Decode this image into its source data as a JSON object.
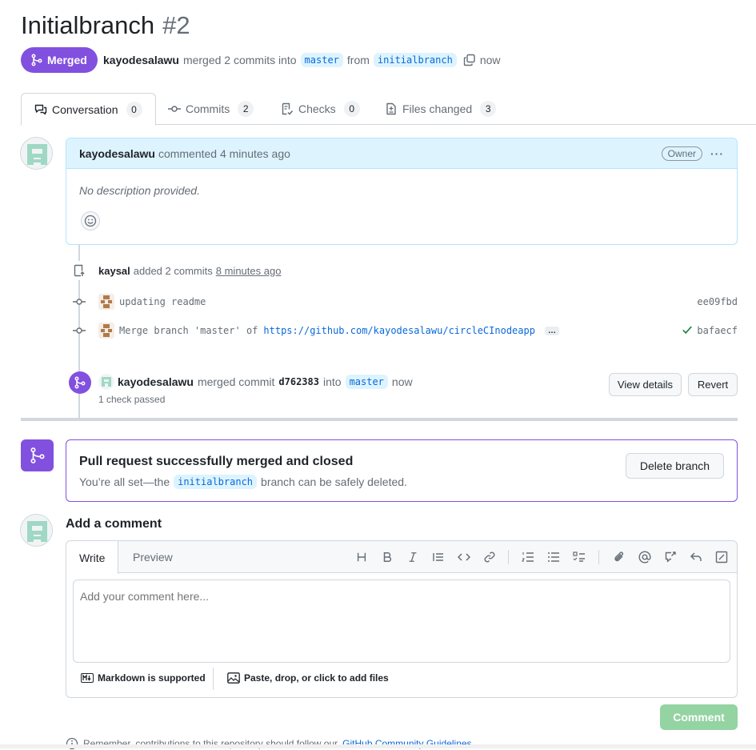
{
  "pr": {
    "title": "Initialbranch",
    "number": "#2",
    "status": "Merged",
    "author": "kayodesalawu",
    "merged_text": "merged 2 commits into",
    "base_branch": "master",
    "from_text": "from",
    "head_branch": "initialbranch",
    "time": "now"
  },
  "tabs": [
    {
      "label": "Conversation",
      "count": "0"
    },
    {
      "label": "Commits",
      "count": "2"
    },
    {
      "label": "Checks",
      "count": "0"
    },
    {
      "label": "Files changed",
      "count": "3"
    }
  ],
  "comment": {
    "author": "kayodesalawu",
    "action": "commented 4 minutes ago",
    "role": "Owner",
    "body": "No description provided."
  },
  "commits_event": {
    "user": "kaysal",
    "action": "added 2 commits",
    "time": "8 minutes ago",
    "commits": [
      {
        "message": "updating readme",
        "sha": "ee09fbd"
      },
      {
        "message_prefix": "Merge branch 'master' of",
        "link": "https://github.com/kayodesalawu/circleCInodeapp",
        "sha": "bafaecf"
      }
    ]
  },
  "merge_event": {
    "user": "kayodesalawu",
    "action": "merged commit",
    "commit": "d762383",
    "into": "into",
    "branch": "master",
    "time": "now",
    "checks": "1 check passed",
    "view_details": "View details",
    "revert": "Revert"
  },
  "merged_box": {
    "title": "Pull request successfully merged and closed",
    "prefix": "You’re all set—the",
    "branch": "initialbranch",
    "suffix": "branch can be safely deleted.",
    "delete_button": "Delete branch"
  },
  "add_comment": {
    "heading": "Add a comment",
    "write_tab": "Write",
    "preview_tab": "Preview",
    "placeholder": "Add your comment here...",
    "markdown_note": "Markdown is supported",
    "attach_note": "Paste, drop, or click to add files",
    "submit": "Comment",
    "remember_prefix": "Remember, contributions to this repository should follow our",
    "remember_link": "GitHub Community Guidelines"
  },
  "colors": {
    "merged_purple": "#8250df",
    "link_blue": "#0969da",
    "comment_header_bg": "#ddf4ff",
    "disabled_green": "#94d3a2"
  }
}
